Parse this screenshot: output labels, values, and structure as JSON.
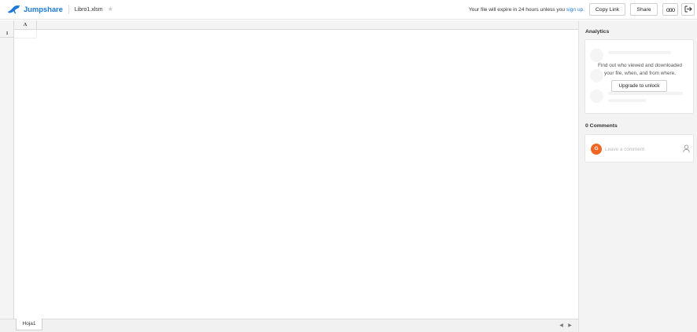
{
  "header": {
    "brand": "Jumpshare",
    "file_name": "Libro1.xlsm",
    "expire_text": "Your file will expire in 24 hours unless you ",
    "signup_link": "sign up.",
    "copy_link_label": "Copy Link",
    "share_label": "Share",
    "more_label": "ooo",
    "icons": [
      "jumpshare-logo-icon",
      "star-icon",
      "exit-icon"
    ]
  },
  "sheet": {
    "column_headers": [
      "A"
    ],
    "row_headers": [
      "1"
    ],
    "tabs": [
      {
        "label": "Hoja1",
        "active": true
      }
    ],
    "nav_prev": "◀",
    "nav_next": "▶"
  },
  "sidebar": {
    "analytics_title": "Analytics",
    "analytics_message": "Find out who viewed and downloaded your file, when, and from where.",
    "upgrade_label": "Upgrade to unlock",
    "comments_title": "0 Comments",
    "comment_placeholder": "Leave a comment",
    "avatar_initial": "G",
    "avatar_color": "#f26522"
  },
  "colors": {
    "brand_blue": "#1e7ad6",
    "panel_bg": "#f3f3f3",
    "header_gray": "#f4f4f4"
  }
}
